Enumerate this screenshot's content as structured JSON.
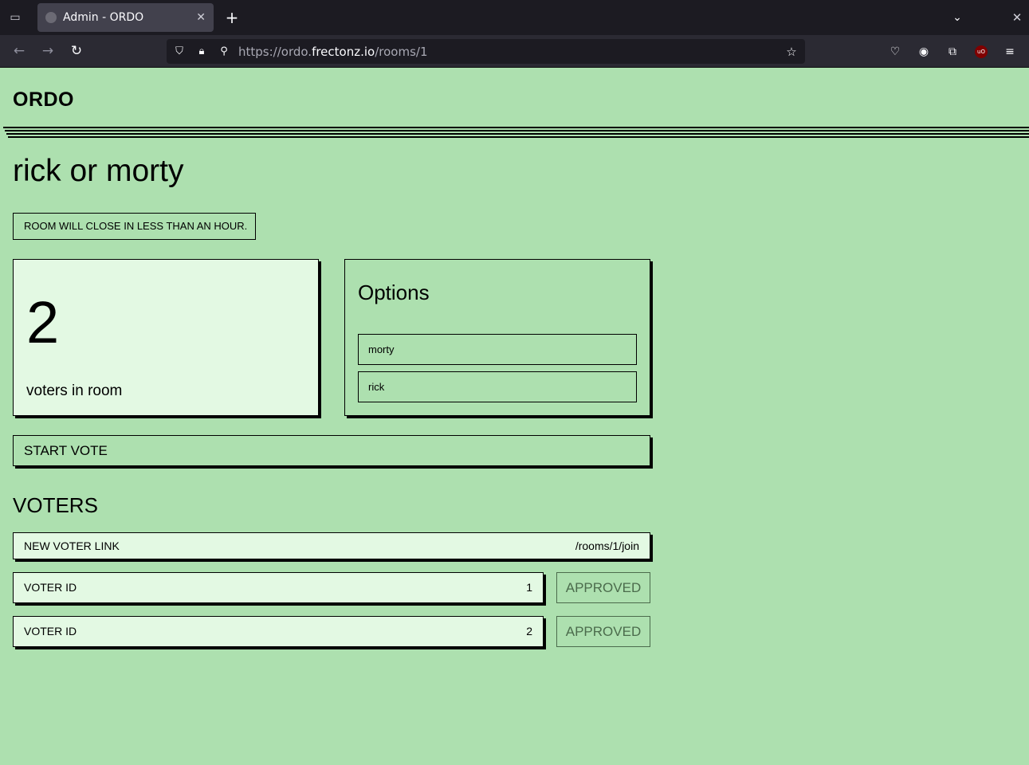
{
  "browser": {
    "tab_title": "Admin - ORDO",
    "url_prefix": "https://ordo.",
    "url_host": "frectonz.io",
    "url_path": "/rooms/1"
  },
  "brand": "ORDO",
  "room": {
    "title": "rick or morty",
    "notice": "ROOM WILL CLOSE IN LESS THAN AN HOUR."
  },
  "count": {
    "value": "2",
    "label": "voters in room"
  },
  "options": {
    "title": "Options",
    "items": [
      "morty",
      "rick"
    ]
  },
  "start_vote_label": "START VOTE",
  "voters": {
    "title": "VOTERS",
    "link_label": "NEW VOTER LINK",
    "link_value": "/rooms/1/join",
    "rows": [
      {
        "label": "VOTER ID",
        "id": "1",
        "status": "APPROVED"
      },
      {
        "label": "VOTER ID",
        "id": "2",
        "status": "APPROVED"
      }
    ]
  }
}
